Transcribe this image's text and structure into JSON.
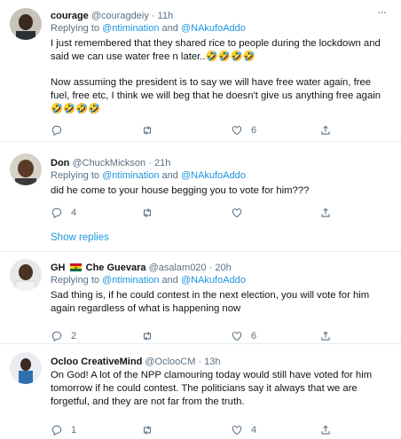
{
  "tweets": [
    {
      "name": "courage",
      "handle": "@couragdeiy",
      "time": "11h",
      "replying_prefix": "Replying to",
      "mention1": "@ntimination",
      "and": "and",
      "mention2": "@NAkufoAddo",
      "body1": "I just remembered that they shared rice to people during the lockdown and said we can use water free n later..🤣🤣🤣🤣",
      "body2": "Now assuming the president is to say we will have free water again, free fuel, free etc, I think we will beg that he doesn't give us anything free again 🤣🤣🤣🤣",
      "replies": "",
      "retweets": "",
      "likes": "6"
    },
    {
      "name": "Don",
      "handle": "@ChuckMickson",
      "time": "21h",
      "replying_prefix": "Replying to",
      "mention1": "@ntimination",
      "and": "and",
      "mention2": "@NAkufoAddo",
      "body1": "did he come to your house begging you to vote for him???",
      "replies": "4",
      "retweets": "",
      "likes": ""
    },
    {
      "name": "GH",
      "name2": "Che Guevara",
      "handle": "@asalam020",
      "time": "20h",
      "replying_prefix": "Replying to",
      "mention1": "@ntimination",
      "and": "and",
      "mention2": "@NAkufoAddo",
      "body1": "Sad thing is, if he could contest in the next election, you will vote for him again regardless of what is happening now",
      "replies": "2",
      "retweets": "",
      "likes": "6"
    },
    {
      "name": "Ocloo CreativeMind",
      "handle": "@OclooCM",
      "time": "13h",
      "body1": "On God! A lot of the NPP clamouring today would still have voted for him tomorrow if he could contest. The politicians say it always that we are forgetful, and they are not far from the truth.",
      "replies": "1",
      "retweets": "",
      "likes": "4"
    }
  ],
  "show_replies": "Show replies",
  "dot": "·",
  "colors": {
    "link": "#1b95e0",
    "secondary": "#5b7083",
    "border": "#e6ecf0"
  }
}
